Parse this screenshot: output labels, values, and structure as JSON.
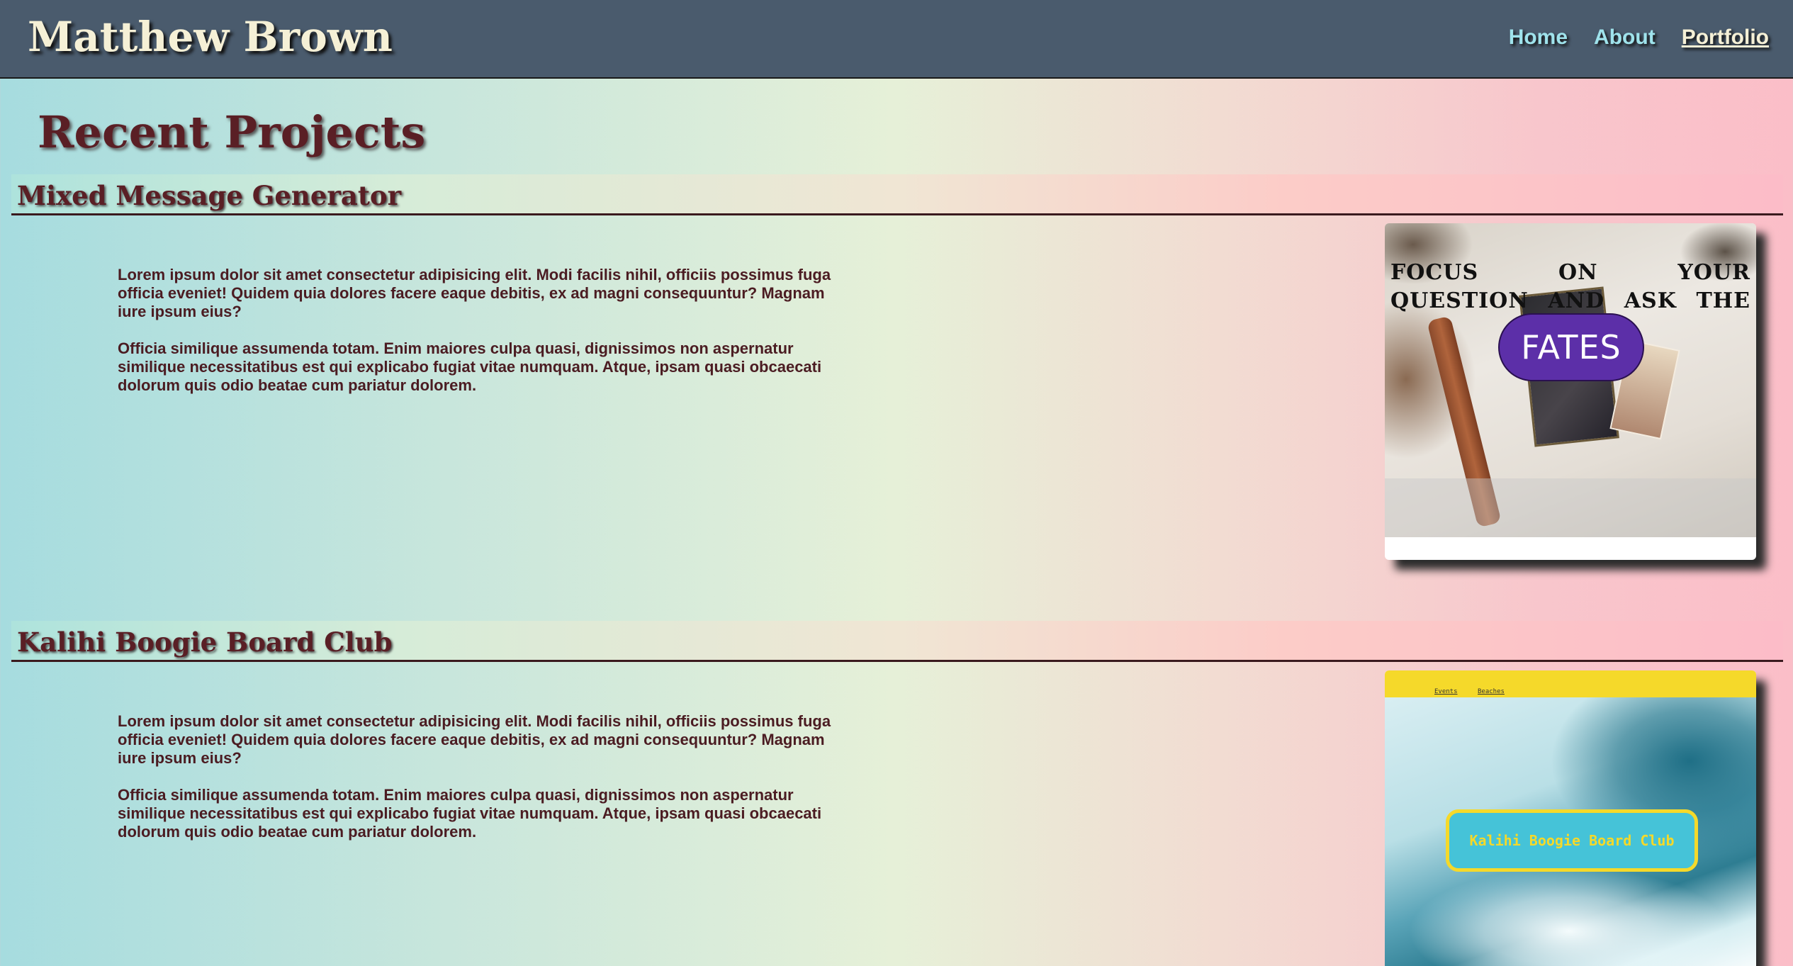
{
  "header": {
    "brand": "Matthew Brown",
    "nav": [
      {
        "label": "Home"
      },
      {
        "label": "About"
      },
      {
        "label": "Portfolio"
      }
    ]
  },
  "main": {
    "title": "Recent Projects",
    "projects": [
      {
        "title": "Mixed Message Generator",
        "paragraphs": [
          "Lorem ipsum dolor sit amet consectetur adipisicing elit. Modi facilis nihil, officiis possimus fuga officia eveniet! Quidem quia dolores facere eaque debitis, ex ad magni consequuntur? Magnam iure ipsum eius?",
          "Officia similique assumenda totam. Enim maiores culpa quasi, dignissimos non aspernatur similique necessitatibus est qui explicabo fugiat vitae numquam. Atque, ipsam quasi obcaecati dolorum quis odio beatae cum pariatur dolorem."
        ],
        "screenshot": {
          "caption": "FOCUS ON YOUR QUESTION AND ASK THE",
          "button": "FATES"
        }
      },
      {
        "title": "Kalihi Boogie Board Club",
        "paragraphs": [
          "Lorem ipsum dolor sit amet consectetur adipisicing elit. Modi facilis nihil, officiis possimus fuga officia eveniet! Quidem quia dolores facere eaque debitis, ex ad magni consequuntur? Magnam iure ipsum eius?",
          "Officia similique assumenda totam. Enim maiores culpa quasi, dignissimos non aspernatur similique necessitatibus est qui explicabo fugiat vitae numquam. Atque, ipsam quasi obcaecati dolorum quis odio beatae cum pariatur dolorem."
        ],
        "screenshot": {
          "nav": [
            "Events",
            "Beaches"
          ],
          "badge": "Kalihi Boogie Board Club"
        }
      }
    ]
  },
  "colors": {
    "header_bg": "#4a5b6d",
    "brand_text": "#f5f0d6",
    "nav_link": "#9fe3ec",
    "title_text": "#5a1f25",
    "body_text": "#4b1c22",
    "fates_button": "#5c2fa8",
    "kalihi_yellow": "#f5d92a",
    "kalihi_badge": "#45c3d8"
  }
}
